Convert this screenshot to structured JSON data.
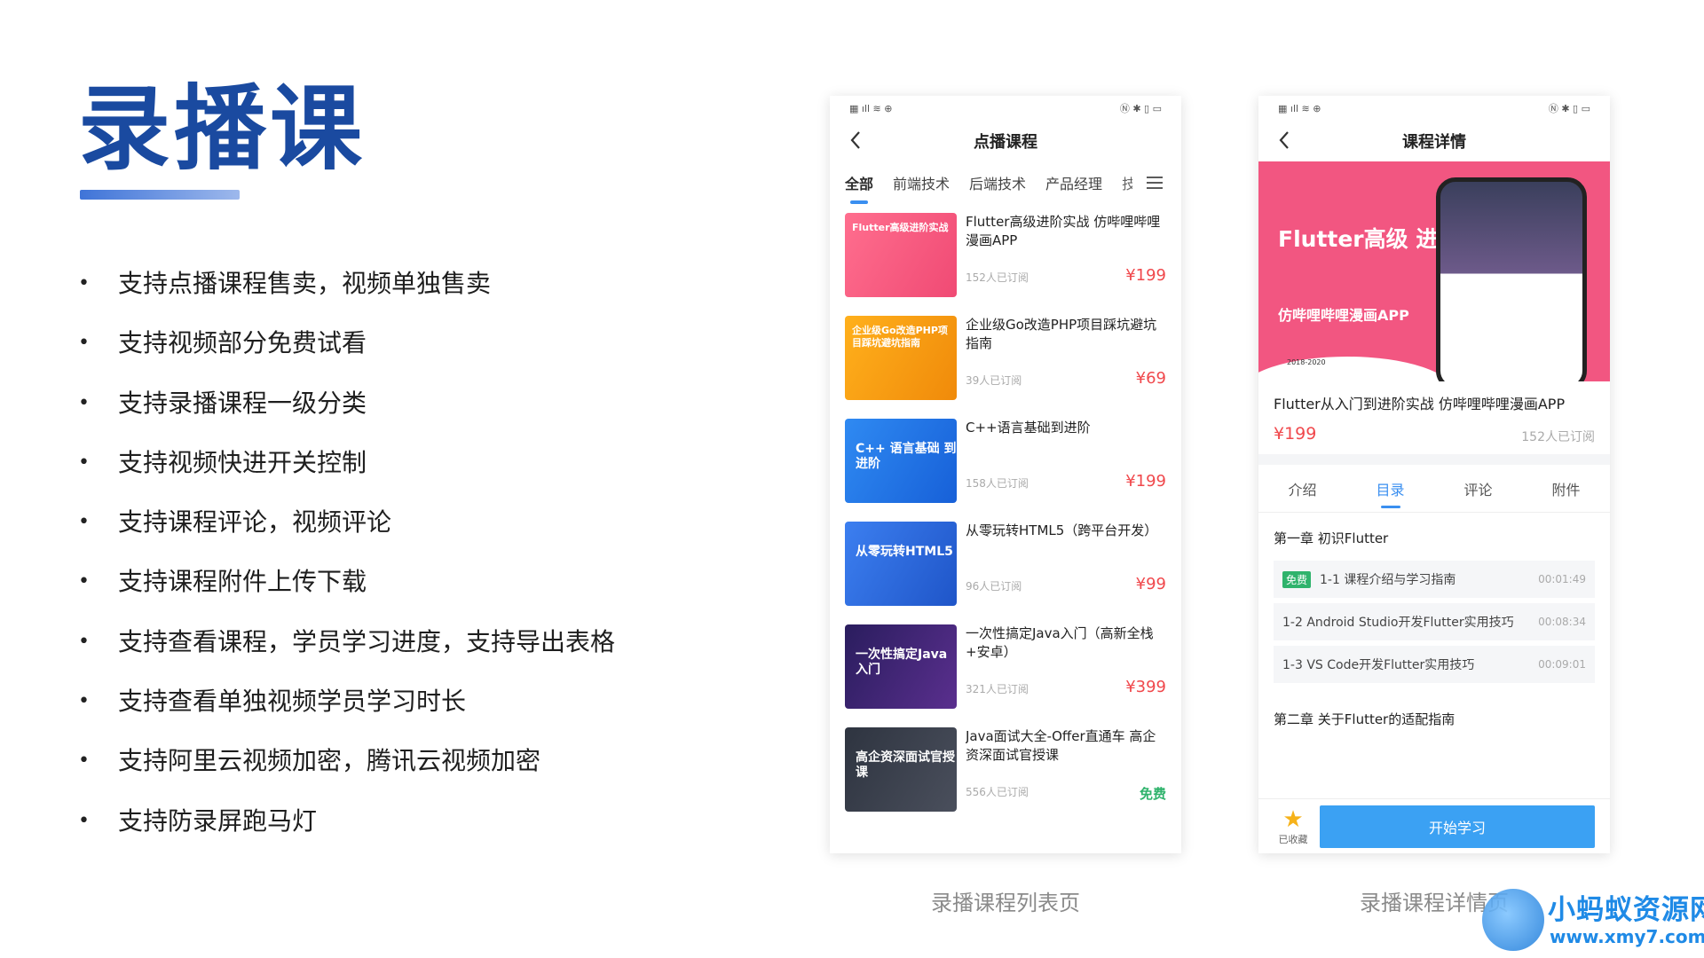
{
  "slide": {
    "title": "录播课",
    "bullets": [
      "支持点播课程售卖，视频单独售卖",
      "支持视频部分免费试看",
      "支持录播课程一级分类",
      "支持视频快进开关控制",
      "支持课程评论，视频评论",
      "支持课程附件上传下载",
      "支持查看课程，学员学习进度，支持导出表格",
      "支持查看单独视频学员学习时长",
      "支持阿里云视频加密，腾讯云视频加密",
      "支持防录屏跑马灯"
    ]
  },
  "list_screen": {
    "nav_title": "点播课程",
    "tabs": [
      "全部",
      "前端技术",
      "后端技术",
      "产品经理",
      "技"
    ],
    "courses": [
      {
        "title": "Flutter高级进阶实战 仿哔哩哔哩漫画APP",
        "subs": "152人已订阅",
        "price": "¥199",
        "thumb_text": "Flutter高级进阶实战"
      },
      {
        "title": "企业级Go改造PHP项目踩坑避坑指南",
        "subs": "39人已订阅",
        "price": "¥69",
        "thumb_text": "企业级Go改造PHP项目踩坑避坑指南"
      },
      {
        "title": "C++语言基础到进阶",
        "subs": "158人已订阅",
        "price": "¥199",
        "thumb_text": "C++ 语言基础 到进阶"
      },
      {
        "title": "从零玩转HTML5（跨平台开发）",
        "subs": "96人已订阅",
        "price": "¥99",
        "thumb_text": "从零玩转HTML5"
      },
      {
        "title": "一次性搞定Java入门（高新全栈+安卓）",
        "subs": "321人已订阅",
        "price": "¥399",
        "thumb_text": "一次性搞定Java入门"
      },
      {
        "title": "Java面试大全-Offer直通车 高企资深面试官授课",
        "subs": "556人已订阅",
        "price": "免费",
        "thumb_text": "高企资深面试官授课"
      }
    ],
    "caption": "录播课程列表页"
  },
  "detail_screen": {
    "nav_title": "课程详情",
    "banner_title": "Flutter高级 进阶实战",
    "banner_sub": "仿哔哩哔哩漫画APP",
    "banner_year": "2018-2020",
    "course_title": "Flutter从入门到进阶实战 仿哔哩哔哩漫画APP",
    "price": "¥199",
    "subs": "152人已订阅",
    "tabs": [
      "介绍",
      "目录",
      "评论",
      "附件"
    ],
    "active_tab": "目录",
    "chapter1": "第一章 初识Flutter",
    "lessons": [
      {
        "badge": "免费",
        "name": "1-1 课程介绍与学习指南",
        "duration": "00:01:49"
      },
      {
        "badge": "",
        "name": "1-2 Android Studio开发Flutter实用技巧",
        "duration": "00:08:34"
      },
      {
        "badge": "",
        "name": "1-3 VS Code开发Flutter实用技巧",
        "duration": "00:09:01"
      }
    ],
    "chapter2": "第二章 关于Flutter的适配指南",
    "fav_label": "已收藏",
    "start_label": "开始学习",
    "caption": "录播课程详情页"
  },
  "watermark": {
    "name": "小蚂蚁资源网",
    "url": "www.xmy7.com"
  },
  "colors": {
    "title_blue": "#1a4aa0",
    "accent_blue": "#3a8ff0",
    "price_red": "#f0484c",
    "free_green": "#2fb36c",
    "banner_pink": "#f25681"
  }
}
